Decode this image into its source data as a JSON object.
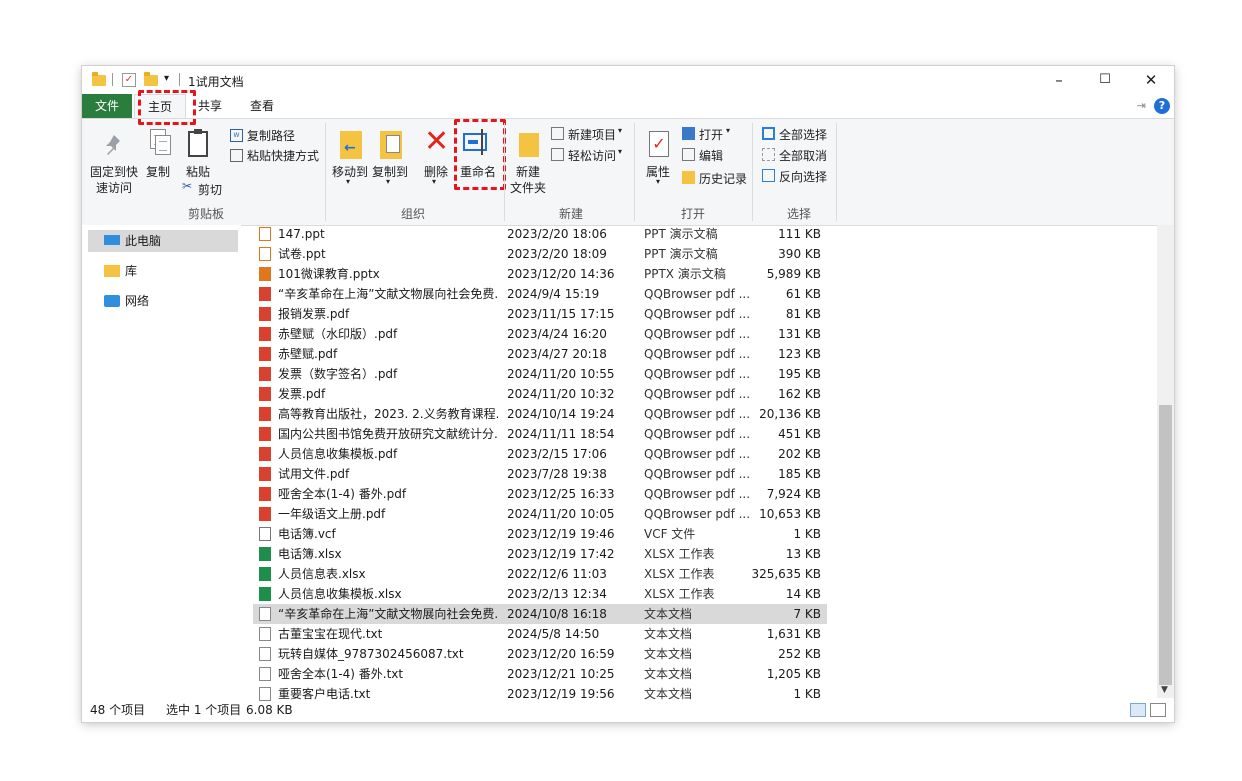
{
  "window": {
    "title": "1试用文档",
    "controls": {
      "minimize": "–",
      "maximize": "☐",
      "close": "✕"
    }
  },
  "tabs": {
    "file": "文件",
    "home": "主页",
    "share": "共享",
    "view": "查看"
  },
  "ribbon": {
    "clipboard": {
      "pin_quick_access_line1": "固定到快",
      "pin_quick_access_line2": "速访问",
      "copy": "复制",
      "paste": "粘贴",
      "copy_path": "复制路径",
      "paste_shortcut": "粘贴快捷方式",
      "cut": "剪切",
      "label": "剪贴板"
    },
    "organize": {
      "move_to": "移动到",
      "copy_to": "复制到",
      "delete": "删除",
      "rename": "重命名",
      "label": "组织"
    },
    "new": {
      "new_folder_line1": "新建",
      "new_folder_line2": "文件夹",
      "new_item": "新建项目",
      "easy_access": "轻松访问",
      "label": "新建"
    },
    "open": {
      "properties": "属性",
      "open": "打开",
      "edit": "编辑",
      "history": "历史记录",
      "label": "打开"
    },
    "select": {
      "select_all": "全部选择",
      "select_none": "全部取消",
      "invert": "反向选择",
      "label": "选择"
    }
  },
  "nav": [
    {
      "label": "此电脑",
      "selected": true
    },
    {
      "label": "库",
      "selected": false
    },
    {
      "label": "网络",
      "selected": false
    }
  ],
  "files": [
    {
      "name": "147.ppt",
      "date": "2023/2/20 18:06",
      "type": "PPT 演示文稿",
      "size": "111 KB",
      "kind": "ppt"
    },
    {
      "name": "试卷.ppt",
      "date": "2023/2/20 18:09",
      "type": "PPT 演示文稿",
      "size": "390 KB",
      "kind": "ppt"
    },
    {
      "name": "101微课教育.pptx",
      "date": "2023/12/20 14:36",
      "type": "PPTX 演示文稿",
      "size": "5,989 KB",
      "kind": "pptx"
    },
    {
      "name": "“辛亥革命在上海”文献文物展向社会免费...",
      "date": "2024/9/4 15:19",
      "type": "QQBrowser pdf ...",
      "size": "61 KB",
      "kind": "pdf"
    },
    {
      "name": "报销发票.pdf",
      "date": "2023/11/15 17:15",
      "type": "QQBrowser pdf ...",
      "size": "81 KB",
      "kind": "pdf"
    },
    {
      "name": "赤壁赋（水印版）.pdf",
      "date": "2023/4/24 16:20",
      "type": "QQBrowser pdf ...",
      "size": "131 KB",
      "kind": "pdf"
    },
    {
      "name": "赤壁赋.pdf",
      "date": "2023/4/27 20:18",
      "type": "QQBrowser pdf ...",
      "size": "123 KB",
      "kind": "pdf"
    },
    {
      "name": "发票（数字签名）.pdf",
      "date": "2024/11/20 10:55",
      "type": "QQBrowser pdf ...",
      "size": "195 KB",
      "kind": "pdf"
    },
    {
      "name": "发票.pdf",
      "date": "2024/11/20 10:32",
      "type": "QQBrowser pdf ...",
      "size": "162 KB",
      "kind": "pdf"
    },
    {
      "name": "高等教育出版社，2023. 2.义务教育课程...",
      "date": "2024/10/14 19:24",
      "type": "QQBrowser pdf ...",
      "size": "20,136 KB",
      "kind": "pdf"
    },
    {
      "name": "国内公共图书馆免费开放研究文献统计分...",
      "date": "2024/11/11 18:54",
      "type": "QQBrowser pdf ...",
      "size": "451 KB",
      "kind": "pdf"
    },
    {
      "name": "人员信息收集模板.pdf",
      "date": "2023/2/15 17:06",
      "type": "QQBrowser pdf ...",
      "size": "202 KB",
      "kind": "pdf"
    },
    {
      "name": "试用文件.pdf",
      "date": "2023/7/28 19:38",
      "type": "QQBrowser pdf ...",
      "size": "185 KB",
      "kind": "pdf"
    },
    {
      "name": "哑舍全本(1-4) 番外.pdf",
      "date": "2023/12/25 16:33",
      "type": "QQBrowser pdf ...",
      "size": "7,924 KB",
      "kind": "pdf"
    },
    {
      "name": "一年级语文上册.pdf",
      "date": "2024/11/20 10:05",
      "type": "QQBrowser pdf ...",
      "size": "10,653 KB",
      "kind": "pdf"
    },
    {
      "name": "电话簿.vcf",
      "date": "2023/12/19 19:46",
      "type": "VCF 文件",
      "size": "1 KB",
      "kind": "vcf"
    },
    {
      "name": "电话簿.xlsx",
      "date": "2023/12/19 17:42",
      "type": "XLSX 工作表",
      "size": "13 KB",
      "kind": "xlsx"
    },
    {
      "name": "人员信息表.xlsx",
      "date": "2022/12/6 11:03",
      "type": "XLSX 工作表",
      "size": "325,635 KB",
      "kind": "xlsx"
    },
    {
      "name": "人员信息收集模板.xlsx",
      "date": "2023/2/13 12:34",
      "type": "XLSX 工作表",
      "size": "14 KB",
      "kind": "xlsx"
    },
    {
      "name": "“辛亥革命在上海”文献文物展向社会免费...",
      "date": "2024/10/8 16:18",
      "type": "文本文档",
      "size": "7 KB",
      "kind": "txt",
      "selected": true
    },
    {
      "name": "古董宝宝在现代.txt",
      "date": "2024/5/8 14:50",
      "type": "文本文档",
      "size": "1,631 KB",
      "kind": "txt"
    },
    {
      "name": "玩转自媒体_9787302456087.txt",
      "date": "2023/12/20 16:59",
      "type": "文本文档",
      "size": "252 KB",
      "kind": "txt"
    },
    {
      "name": "哑舍全本(1-4) 番外.txt",
      "date": "2023/12/21 10:25",
      "type": "文本文档",
      "size": "1,205 KB",
      "kind": "txt"
    },
    {
      "name": "重要客户电话.txt",
      "date": "2023/12/19 19:56",
      "type": "文本文档",
      "size": "1 KB",
      "kind": "txt"
    }
  ],
  "status": {
    "item_count": "48 个项目",
    "selection": "选中 1 个项目",
    "selection_size": "6.08 KB"
  },
  "colors": {
    "file_tab": "#2b7d3e",
    "highlight": "#e8141b",
    "selection": "#d9d9d9",
    "pdf_icon": "#d9412e",
    "xlsx_icon": "#1e8f4a",
    "ppt_icon": "#e0771f"
  }
}
